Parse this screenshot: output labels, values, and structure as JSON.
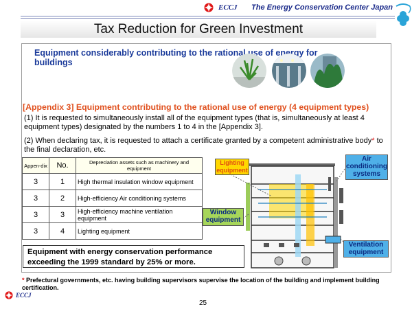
{
  "header": {
    "eccj_label": "ECCJ",
    "center_name": "The Energy Conservation Center Japan"
  },
  "title": "Tax Reduction for Green Investment",
  "section": {
    "heading": "Equipment considerably contributing to the rational use of energy for buildings",
    "appendix_title": "[Appendix 3] Equipment contributing to the rational use of energy (4 equipment types)",
    "point1": "(1) It is requested to simultaneously install all of the equipment types (that is, simultaneously at least 4 equipment types) designated by the numbers 1 to 4 in the [Appendix 3].",
    "point2": "(2) When declaring tax, it is requested to attach a certificate granted by a competent administrative body",
    "point2_star": "*",
    "point2_tail": " to the final declaration, etc."
  },
  "table": {
    "headers": [
      "Appen-dix",
      "No.",
      "Depreciation assets such as machinery and equipment"
    ],
    "rows": [
      [
        "3",
        "1",
        "High thermal insulation window equipment"
      ],
      [
        "3",
        "2",
        "High-efficiency Air conditioning systems"
      ],
      [
        "3",
        "3",
        "High-efficiency machine ventilation equipment"
      ],
      [
        "3",
        "4",
        "Lighting equipment"
      ]
    ]
  },
  "performance_box": "Equipment with energy conservation performance exceeding the 1999 standard by 25% or more.",
  "diagram_labels": {
    "lighting": "Lighting equipment",
    "air": "Air conditioning systems",
    "window": "Window equipment",
    "ventilation": "Ventilation equipment"
  },
  "footnote_star": "*",
  "footnote": " Prefectural governments, etc. having building supervisors supervise the location of the building and implement building certification.",
  "footer_eccj": "ECCJ",
  "page_number": "25",
  "colors": {
    "navy": "#1a2a8a",
    "blue_heading": "#1a3a9a",
    "orange_heading": "#e0501e",
    "light_label": "#ffd700",
    "air_label": "#4fb0e8",
    "window_label": "#a6d65a"
  }
}
